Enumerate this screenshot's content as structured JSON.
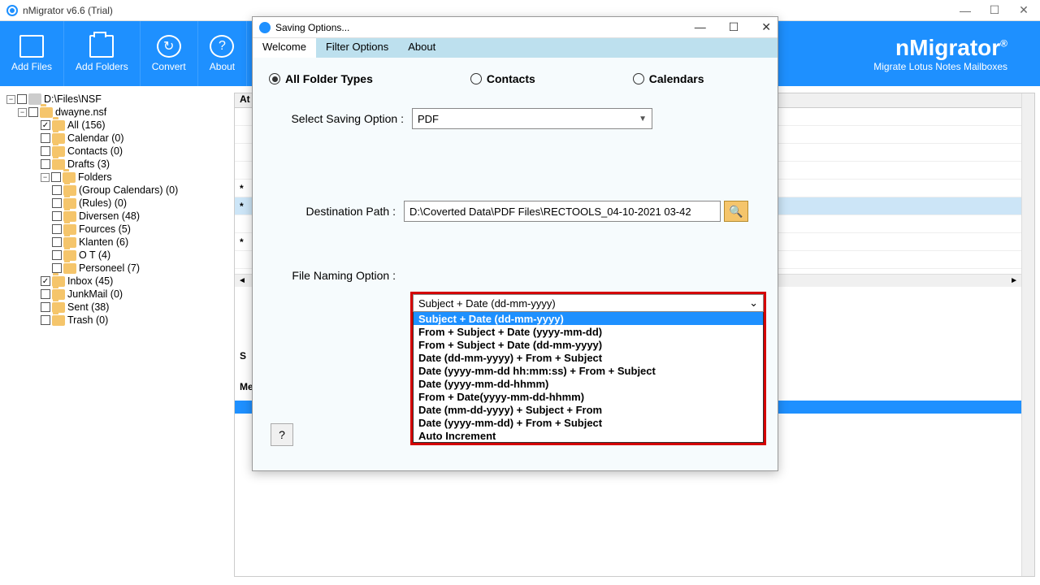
{
  "titlebar": {
    "title": "nMigrator v6.6 (Trial)"
  },
  "ribbon": {
    "items": [
      {
        "label": "Add Files"
      },
      {
        "label": "Add Folders"
      },
      {
        "label": "Convert"
      },
      {
        "label": "About"
      }
    ],
    "brand_name": "nMigrator",
    "brand_tag": "Migrate Lotus Notes Mailboxes"
  },
  "tree": {
    "root": "D:\\Files\\NSF",
    "file": "dwayne.nsf",
    "nodes": [
      {
        "label": "All (156)",
        "checked": true,
        "indent": 3
      },
      {
        "label": "Calendar (0)",
        "checked": false,
        "indent": 3
      },
      {
        "label": "Contacts (0)",
        "checked": false,
        "indent": 3
      },
      {
        "label": "Drafts (3)",
        "checked": false,
        "indent": 3
      },
      {
        "label": "Folders",
        "checked": false,
        "indent": 3,
        "expandable": true
      },
      {
        "label": "(Group Calendars) (0)",
        "checked": false,
        "indent": 4
      },
      {
        "label": "(Rules) (0)",
        "checked": false,
        "indent": 4
      },
      {
        "label": "Diversen (48)",
        "checked": false,
        "indent": 4
      },
      {
        "label": "Fources (5)",
        "checked": false,
        "indent": 4
      },
      {
        "label": "Klanten (6)",
        "checked": false,
        "indent": 4
      },
      {
        "label": "O T (4)",
        "checked": false,
        "indent": 4
      },
      {
        "label": "Personeel (7)",
        "checked": false,
        "indent": 4
      },
      {
        "label": "Inbox (45)",
        "checked": true,
        "indent": 3
      },
      {
        "label": "JunkMail (0)",
        "checked": false,
        "indent": 3
      },
      {
        "label": "Sent (38)",
        "checked": false,
        "indent": 3
      },
      {
        "label": "Trash (0)",
        "checked": false,
        "indent": 3
      }
    ]
  },
  "grid": {
    "header": "At",
    "section1": "S",
    "section2": "Me",
    "section3": "S"
  },
  "modal": {
    "title": "Saving Options...",
    "tabs": [
      {
        "label": "Welcome",
        "active": true
      },
      {
        "label": "Filter Options",
        "active": false
      },
      {
        "label": "About",
        "active": false
      }
    ],
    "radios": [
      {
        "label": "All Folder Types",
        "selected": true
      },
      {
        "label": "Contacts",
        "selected": false
      },
      {
        "label": "Calendars",
        "selected": false
      }
    ],
    "saving_label": "Select Saving Option :",
    "saving_value": "PDF",
    "dest_label": "Destination Path :",
    "dest_value": "D:\\Coverted Data\\PDF Files\\RECTOOLS_04-10-2021 03-42",
    "naming_label": "File Naming Option :",
    "naming_value": "Subject + Date (dd-mm-yyyy)",
    "naming_options": [
      "Subject + Date (dd-mm-yyyy)",
      "From + Subject + Date (yyyy-mm-dd)",
      "From + Subject + Date (dd-mm-yyyy)",
      "Date (dd-mm-yyyy) + From + Subject",
      "Date (yyyy-mm-dd hh:mm:ss) + From + Subject",
      "Date (yyyy-mm-dd-hhmm)",
      "From + Date(yyyy-mm-dd-hhmm)",
      "Date (mm-dd-yyyy) + Subject + From",
      "Date (yyyy-mm-dd) + From + Subject",
      "Auto Increment"
    ],
    "help": "?"
  }
}
